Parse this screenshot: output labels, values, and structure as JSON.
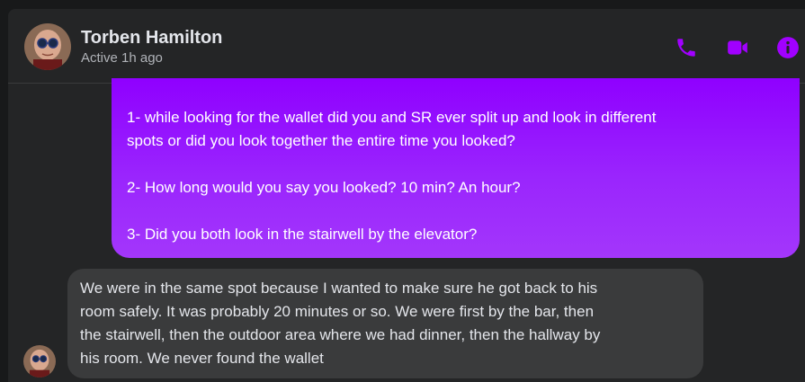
{
  "header": {
    "contact_name": "Torben Hamilton",
    "status": "Active 1h ago",
    "icons": [
      "phone-icon",
      "video-camera-icon",
      "info-icon"
    ]
  },
  "messages": [
    {
      "direction": "outgoing",
      "lines": [
        "1- while looking for the wallet did you and SR ever split up and look in different",
        "spots or did you look together the entire time you looked?",
        "2- How long would you say you looked? 10 min? An hour?",
        "3- Did you both look in the stairwell by the elevator?"
      ]
    },
    {
      "direction": "incoming",
      "lines": [
        "We were in the same spot because I wanted to make sure he got back to his",
        "room safely. It was probably 20 minutes or so. We were first by the bar, then",
        "the stairwell, then the outdoor area where we had dinner, then the hallway by",
        "his room. We never found the wallet"
      ]
    }
  ],
  "colors": {
    "accent": "#a100ff",
    "outgoing_bubble_top": "#8f00ff",
    "outgoing_bubble_bottom": "#a336fb",
    "incoming_bubble": "#3a3b3c",
    "panel": "#242526"
  }
}
